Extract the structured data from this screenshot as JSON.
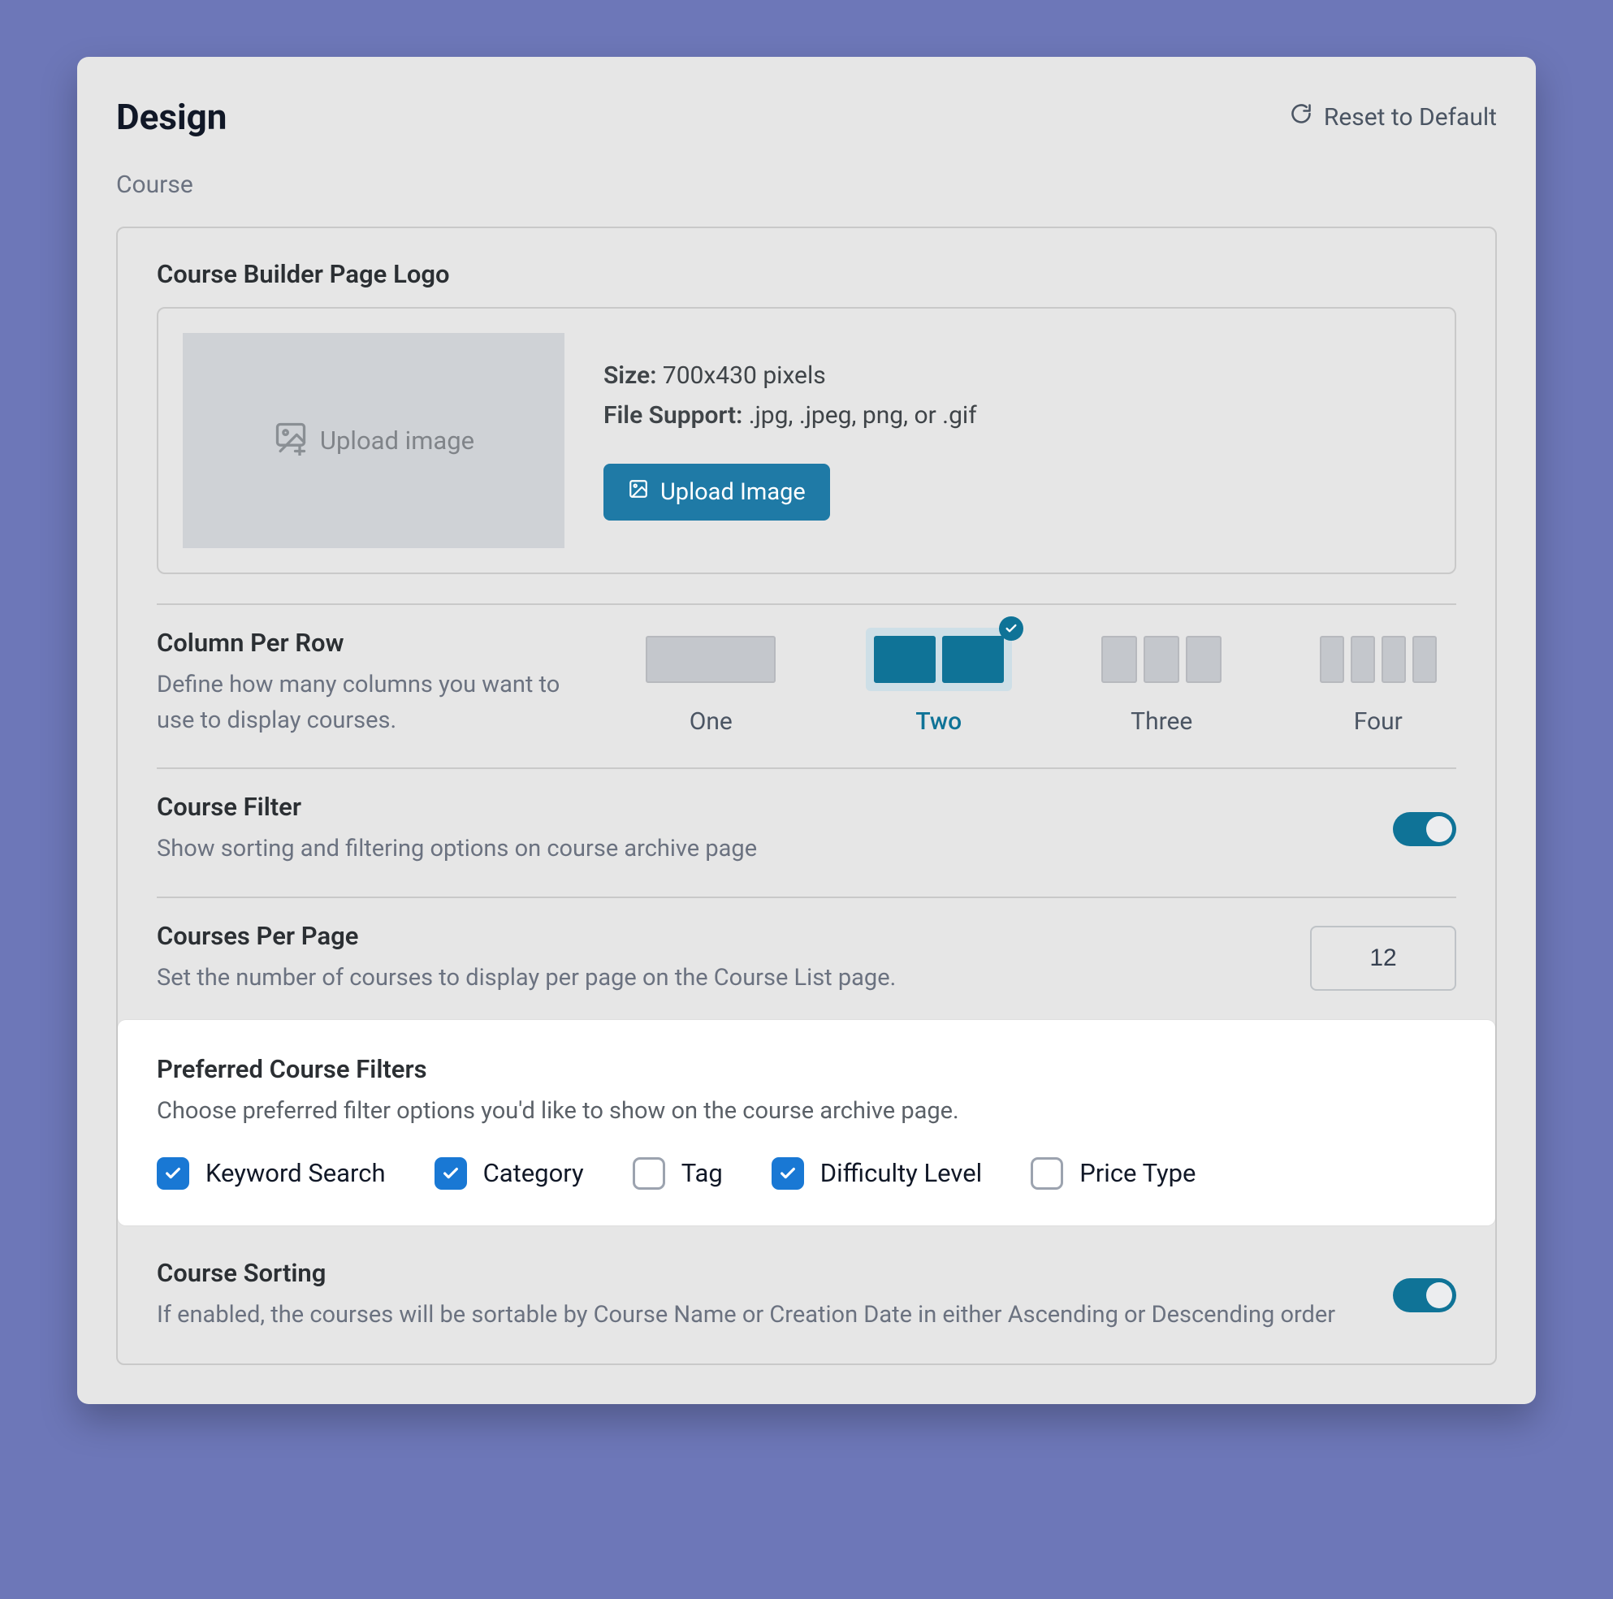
{
  "header": {
    "title": "Design",
    "reset_label": "Reset to Default",
    "breadcrumb": "Course"
  },
  "logo": {
    "section_title": "Course Builder Page Logo",
    "placeholder": "Upload image",
    "size_label": "Size:",
    "size_value": "700x430 pixels",
    "support_label": "File Support:",
    "support_value": ".jpg, .jpeg, png, or .gif",
    "button": "Upload Image"
  },
  "columns": {
    "title": "Column Per Row",
    "desc": "Define how many columns you want to use to display courses.",
    "options": [
      "One",
      "Two",
      "Three",
      "Four"
    ],
    "selected_index": 1
  },
  "filter": {
    "title": "Course Filter",
    "desc": "Show sorting and filtering options on course archive page",
    "enabled": true
  },
  "per_page": {
    "title": "Courses Per Page",
    "desc": "Set the number of courses to display per page on the Course List page.",
    "value": "12"
  },
  "pref_filters": {
    "title": "Preferred Course Filters",
    "desc": "Choose preferred filter options you'd like to show on the course archive page.",
    "items": [
      {
        "label": "Keyword Search",
        "checked": true
      },
      {
        "label": "Category",
        "checked": true
      },
      {
        "label": "Tag",
        "checked": false
      },
      {
        "label": "Difficulty Level",
        "checked": true
      },
      {
        "label": "Price Type",
        "checked": false
      }
    ]
  },
  "sorting": {
    "title": "Course Sorting",
    "desc": "If enabled, the courses will be sortable by Course Name or Creation Date in either Ascending or Descending order",
    "enabled": true
  }
}
